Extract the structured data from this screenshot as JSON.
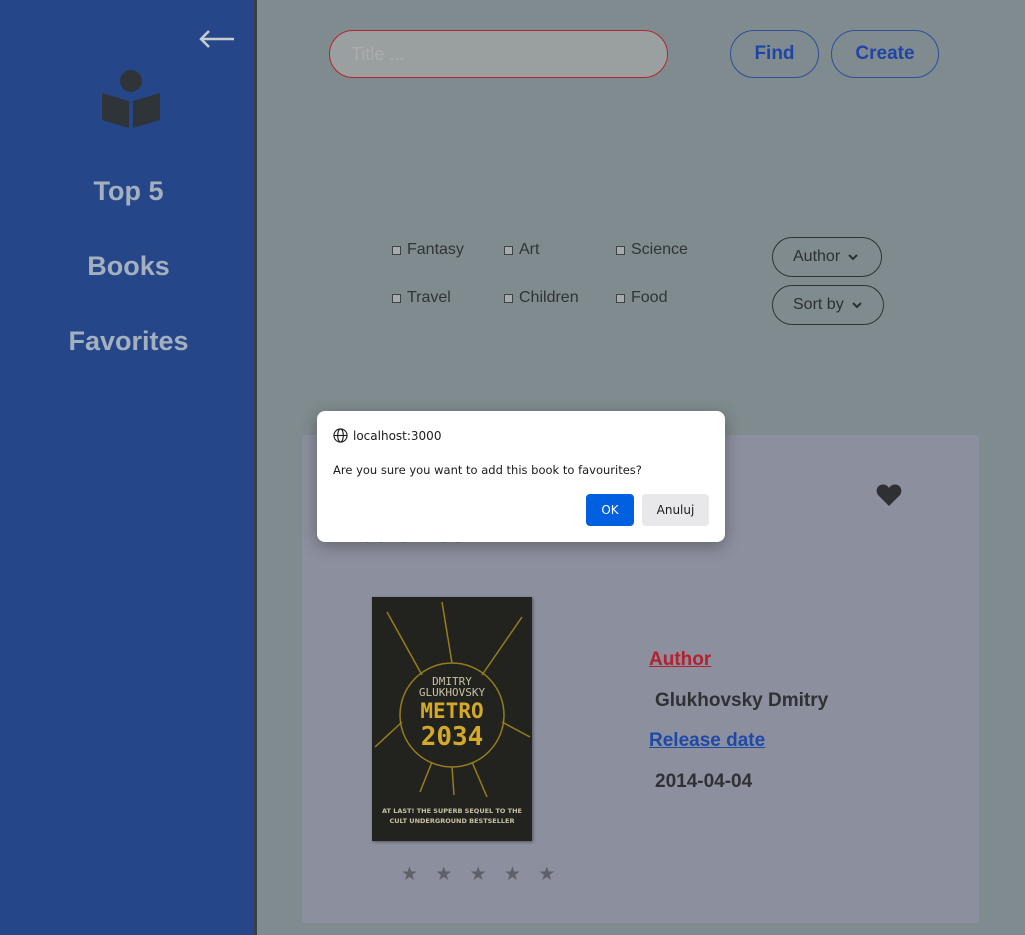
{
  "sidebar": {
    "nav": [
      "Top 5",
      "Books",
      "Favorites"
    ]
  },
  "search": {
    "placeholder": "Title ...",
    "value": ""
  },
  "buttons": {
    "find": "Find",
    "create": "Create"
  },
  "filters": {
    "categories": [
      "Fantasy",
      "Art",
      "Science",
      "Travel",
      "Children",
      "Food"
    ]
  },
  "dropdowns": {
    "author": "Author",
    "sort": "Sort by"
  },
  "card": {
    "title_partial": "Metro 2034",
    "cover": {
      "author_line1": "DMITRY",
      "author_line2": "GLUKHOVSKY",
      "title_line1": "METRO",
      "title_line2": "2034",
      "tagline1": "AT LAST! THE SUPERB SEQUEL TO THE",
      "tagline2": "CULT UNDERGROUND BESTSELLER"
    },
    "stars": "★ ★ ★ ★ ★",
    "author_label": "Author",
    "author_value": "Glukhovsky Dmitry",
    "release_label": "Release date",
    "release_value": "2014-04-04"
  },
  "dialog": {
    "origin": "localhost:3000",
    "message": "Are you sure you want to add this book to favourites?",
    "ok": "OK",
    "cancel": "Anuluj"
  },
  "colors": {
    "sidebar": "#25478a",
    "accent_blue": "#1f45a8",
    "author_label": "#b3202e",
    "release_label": "#1d4aa6",
    "dialog_ok": "#0060df"
  }
}
